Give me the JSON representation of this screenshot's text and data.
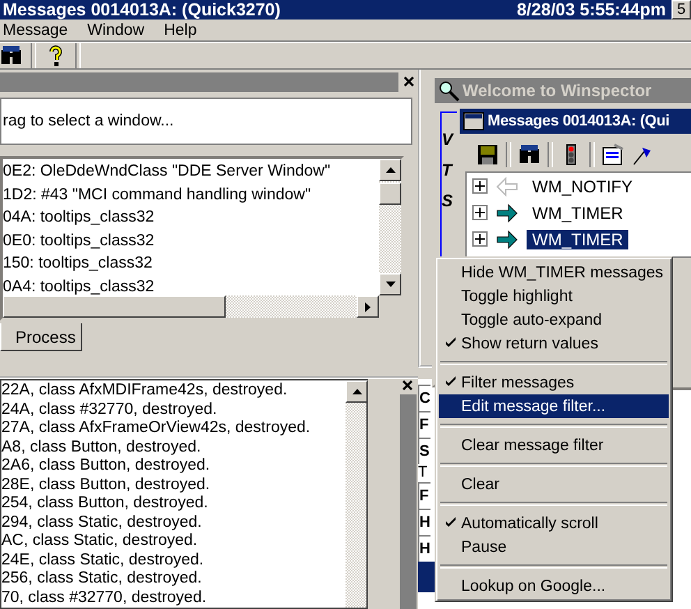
{
  "title_bar": {
    "title": "Messages 0014013A: (Quick3270)",
    "clock": "8/28/03 5:55:44pm",
    "button": "5"
  },
  "menu": [
    "Message",
    "Window",
    "Help"
  ],
  "finder": {
    "hint": "rag to select a window..."
  },
  "window_list": [
    "0E2: OleDdeWndClass  \"DDE Server Window\"",
    "1D2: #43  \"MCI command handling window\"",
    "04A: tooltips_class32",
    "0E0: tooltips_class32",
    "150: tooltips_class32",
    "0A4: tooltips_class32"
  ],
  "tabs": [
    {
      "label": "Process",
      "selected": true
    }
  ],
  "log": [
    "22A, class AfxMDIFrame42s, destroyed.",
    "24A, class #32770, destroyed.",
    "27A, class AfxFrameOrView42s, destroyed.",
    "A8, class Button, destroyed.",
    "2A6, class Button, destroyed.",
    "28E, class Button, destroyed.",
    "254, class Button, destroyed.",
    "294, class Static, destroyed.",
    "AC, class Static, destroyed.",
    "24E, class Static, destroyed.",
    "256, class Static, destroyed.",
    "70, class #32770, destroyed."
  ],
  "welcome_window": {
    "title": "Welcome to Winspector",
    "letters": [
      "V",
      "T",
      "S"
    ]
  },
  "messages_window": {
    "title": "Messages 0014013A: (Qui",
    "messages": [
      {
        "name": "WM_NOTIFY",
        "kind": "returned",
        "selected": false
      },
      {
        "name": "WM_TIMER",
        "kind": "sent",
        "selected": false
      },
      {
        "name": "WM_TIMER",
        "kind": "sent",
        "selected": true
      }
    ]
  },
  "context_menu": [
    {
      "kind": "item",
      "label": "Hide WM_TIMER messages",
      "checked": false,
      "selected": false
    },
    {
      "kind": "item",
      "label": "Toggle highlight",
      "checked": false,
      "selected": false
    },
    {
      "kind": "item",
      "label": "Toggle auto-expand",
      "checked": false,
      "selected": false
    },
    {
      "kind": "item",
      "label": "Show return values",
      "checked": true,
      "selected": false
    },
    {
      "kind": "separator"
    },
    {
      "kind": "item",
      "label": "Filter messages",
      "checked": true,
      "selected": false
    },
    {
      "kind": "item",
      "label": "Edit message filter...",
      "checked": false,
      "selected": true
    },
    {
      "kind": "separator"
    },
    {
      "kind": "item",
      "label": "Clear message filter",
      "checked": false,
      "selected": false
    },
    {
      "kind": "separator"
    },
    {
      "kind": "item",
      "label": "Clear",
      "checked": false,
      "selected": false
    },
    {
      "kind": "separator"
    },
    {
      "kind": "item",
      "label": "Automatically scroll",
      "checked": true,
      "selected": false
    },
    {
      "kind": "item",
      "label": "Pause",
      "checked": false,
      "selected": false
    },
    {
      "kind": "separator"
    },
    {
      "kind": "item",
      "label": "Lookup on Google...",
      "checked": false,
      "selected": false
    }
  ],
  "details": [
    {
      "text": "C",
      "kind": "boxed"
    },
    {
      "text": "F",
      "kind": "boxed"
    },
    {
      "text": "S",
      "kind": "boxed"
    },
    {
      "text": "T",
      "kind": "plain"
    },
    {
      "text": "F",
      "kind": "boxed"
    },
    {
      "text": "H",
      "kind": "boxed"
    },
    {
      "text": "H",
      "kind": "boxed"
    }
  ]
}
